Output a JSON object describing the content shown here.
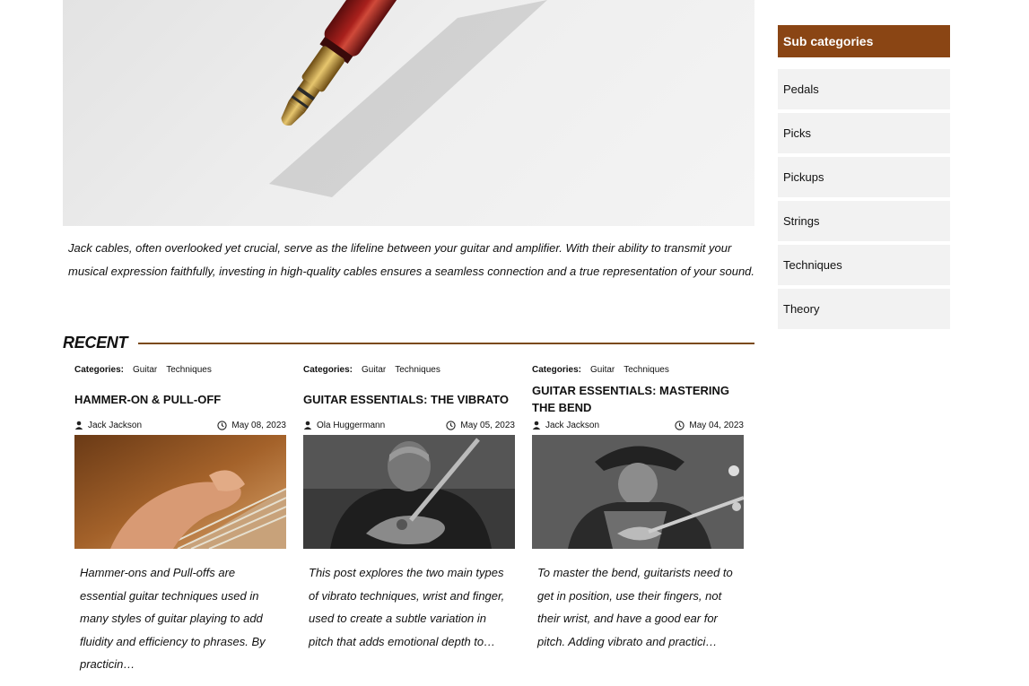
{
  "hero": {
    "caption": "Jack cables, often overlooked yet crucial, serve as the lifeline between your guitar and amplifier. With their ability to transmit your musical expression faithfully, investing in high-quality cables ensures a seamless connection and a true representation of your sound."
  },
  "recent": {
    "title": "RECENT",
    "categories_label": "Categories:",
    "posts": [
      {
        "categories": [
          "Guitar",
          "Techniques"
        ],
        "title": "HAMMER-ON & PULL-OFF",
        "author": "Jack Jackson",
        "date": "May 08, 2023",
        "excerpt": "Hammer-ons and Pull-offs are essential guitar techniques used in many styles of guitar playing to add fluidity and efficiency to phrases. By practicin…"
      },
      {
        "categories": [
          "Guitar",
          "Techniques"
        ],
        "title": "GUITAR ESSENTIALS: THE VIBRATO",
        "author": "Ola Huggermann",
        "date": "May 05, 2023",
        "excerpt": "This post explores the two main types of vibrato techniques, wrist and finger, used to create a subtle variation in pitch that adds emotional depth to…"
      },
      {
        "categories": [
          "Guitar",
          "Techniques"
        ],
        "title": "GUITAR ESSENTIALS: MASTERING THE BEND",
        "author": "Jack Jackson",
        "date": "May 04, 2023",
        "excerpt": "To master the bend, guitarists need to get in position, use their fingers, not their wrist, and have a good ear for pitch. Adding vibrato and practici…"
      }
    ]
  },
  "sidebar": {
    "title": "Sub categories",
    "items": [
      "Pedals",
      "Picks",
      "Pickups",
      "Strings",
      "Techniques",
      "Theory"
    ]
  },
  "colors": {
    "accent": "#8a4514",
    "divider": "#7a4a16",
    "item_bg": "#f2f2f2"
  },
  "icons": {
    "author": "user-icon",
    "date": "clock-icon"
  }
}
